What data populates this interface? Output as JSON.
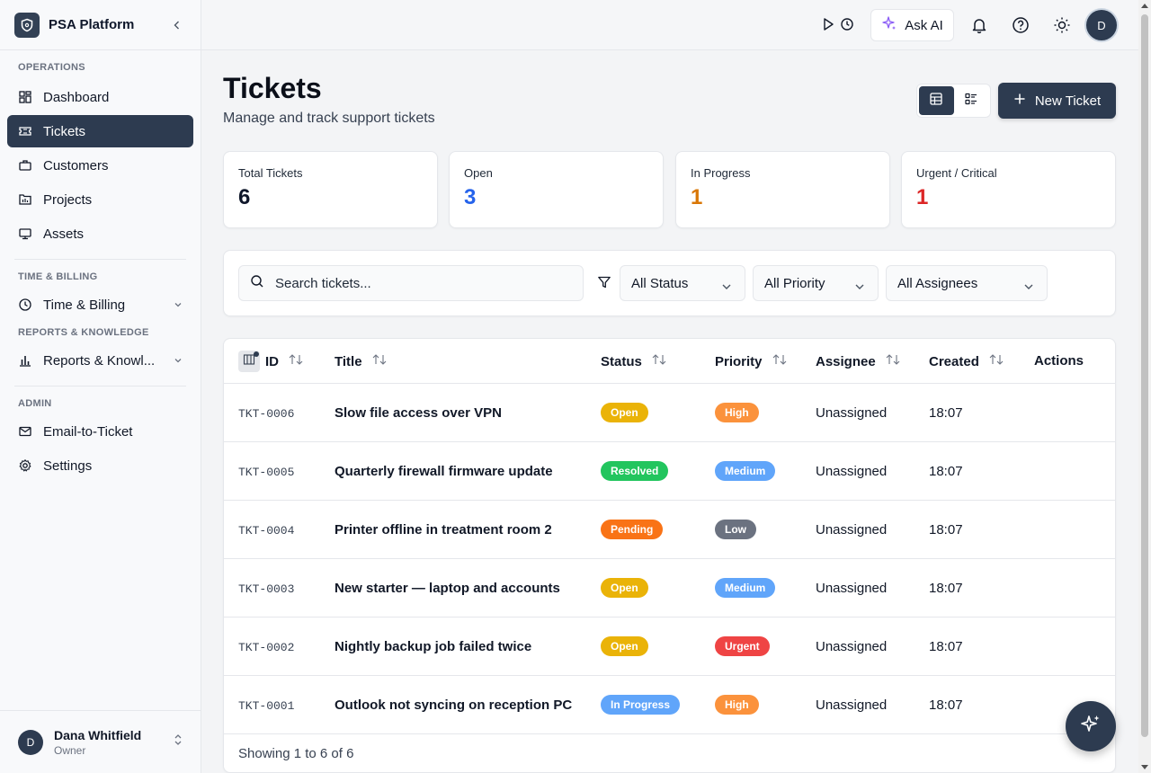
{
  "app": {
    "name": "PSA Platform"
  },
  "sidebar": {
    "sections": [
      {
        "label": "OPERATIONS"
      },
      {
        "label": "TIME & BILLING"
      },
      {
        "label": "REPORTS & KNOWLEDGE"
      },
      {
        "label": "ADMIN"
      }
    ],
    "items": [
      {
        "label": "Dashboard",
        "icon": "dashboard-icon"
      },
      {
        "label": "Tickets",
        "icon": "ticket-icon",
        "active": true
      },
      {
        "label": "Customers",
        "icon": "briefcase-icon"
      },
      {
        "label": "Projects",
        "icon": "chart-icon"
      },
      {
        "label": "Assets",
        "icon": "monitor-icon"
      },
      {
        "label": "Time & Billing",
        "icon": "clock-icon"
      },
      {
        "label": "Reports & Knowl...",
        "icon": "bar-chart-icon"
      },
      {
        "label": "Email-to-Ticket",
        "icon": "mail-icon"
      },
      {
        "label": "Settings",
        "icon": "gear-icon"
      }
    ],
    "user": {
      "initial": "D",
      "name": "Dana Whitfield",
      "role": "Owner"
    }
  },
  "topbar": {
    "ask_ai_label": "Ask AI",
    "avatar_initial": "D"
  },
  "header": {
    "title": "Tickets",
    "subtitle": "Manage and track support tickets",
    "new_button_label": "New Ticket"
  },
  "stats": [
    {
      "label": "Total Tickets",
      "value": "6",
      "color": "#0f172a"
    },
    {
      "label": "Open",
      "value": "3",
      "color": "#2563eb"
    },
    {
      "label": "In Progress",
      "value": "1",
      "color": "#d97706"
    },
    {
      "label": "Urgent / Critical",
      "value": "1",
      "color": "#dc2626"
    }
  ],
  "filters": {
    "search_placeholder": "Search tickets...",
    "status": "All Status",
    "priority": "All Priority",
    "assignee": "All Assignees"
  },
  "table": {
    "columns": [
      "ID",
      "Title",
      "Status",
      "Priority",
      "Assignee",
      "Created",
      "Actions"
    ],
    "rows": [
      {
        "id": "TKT-0006",
        "title": "Slow file access over VPN",
        "status": "Open",
        "priority": "High",
        "assignee": "Unassigned",
        "created": "18:07"
      },
      {
        "id": "TKT-0005",
        "title": "Quarterly firewall firmware update",
        "status": "Resolved",
        "priority": "Medium",
        "assignee": "Unassigned",
        "created": "18:07"
      },
      {
        "id": "TKT-0004",
        "title": "Printer offline in treatment room 2",
        "status": "Pending",
        "priority": "Low",
        "assignee": "Unassigned",
        "created": "18:07"
      },
      {
        "id": "TKT-0003",
        "title": "New starter — laptop and accounts",
        "status": "Open",
        "priority": "Medium",
        "assignee": "Unassigned",
        "created": "18:07"
      },
      {
        "id": "TKT-0002",
        "title": "Nightly backup job failed twice",
        "status": "Open",
        "priority": "Urgent",
        "assignee": "Unassigned",
        "created": "18:07"
      },
      {
        "id": "TKT-0001",
        "title": "Outlook not syncing on reception PC",
        "status": "In Progress",
        "priority": "High",
        "assignee": "Unassigned",
        "created": "18:07"
      }
    ],
    "footer": "Showing 1 to 6 of 6"
  },
  "colors": {
    "status": {
      "Open": "#eab308",
      "Resolved": "#22c55e",
      "Pending": "#f97316",
      "In Progress": "#60a5fa"
    },
    "priority": {
      "High": "#fb923c",
      "Medium": "#60a5fa",
      "Low": "#6b7280",
      "Urgent": "#ef4444"
    }
  }
}
